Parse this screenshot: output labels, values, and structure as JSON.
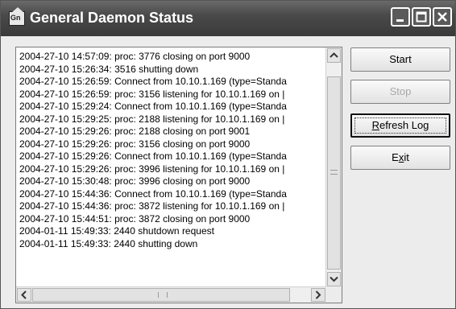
{
  "window": {
    "title": "General Daemon Status",
    "icon_text": "Gn"
  },
  "log": {
    "lines": [
      "2004-27-10 14:57:09: proc: 3776 closing on port 9000",
      "2004-27-10 15:26:34: 3516 shutting down",
      "2004-27-10 15:26:59: Connect from 10.10.1.169 (type=Standa",
      "2004-27-10 15:26:59: proc: 3156 listening for 10.10.1.169 on |",
      "2004-27-10 15:29:24: Connect from 10.10.1.169 (type=Standa",
      "2004-27-10 15:29:25: proc: 2188 listening for 10.10.1.169 on |",
      "2004-27-10 15:29:26: proc: 2188 closing on port 9001",
      "2004-27-10 15:29:26: proc: 3156 closing on port 9000",
      "2004-27-10 15:29:26: Connect from 10.10.1.169 (type=Standa",
      "2004-27-10 15:29:26: proc: 3996 listening for 10.10.1.169 on |",
      "2004-27-10 15:30:48: proc: 3996 closing on port 9000",
      "2004-27-10 15:44:36: Connect from 10.10.1.169 (type=Standa",
      "2004-27-10 15:44:36: proc: 3872 listening for 10.10.1.169 on |",
      "2004-27-10 15:44:51: proc: 3872 closing on port 9000",
      "2004-01-11 15:49:33: 2440 shutdown request",
      "2004-01-11 15:49:33: 2440 shutting down"
    ]
  },
  "buttons": {
    "start": "Start",
    "stop": "Stop",
    "refresh_log": {
      "accel": "R",
      "rest": "efresh Log"
    },
    "exit": {
      "pre": "E",
      "accel": "x",
      "rest": "it"
    }
  },
  "icons": [
    "app-icon",
    "minimize-icon",
    "maximize-icon",
    "close-icon",
    "scroll-up-icon",
    "scroll-down-icon",
    "scroll-left-icon",
    "scroll-right-icon"
  ]
}
